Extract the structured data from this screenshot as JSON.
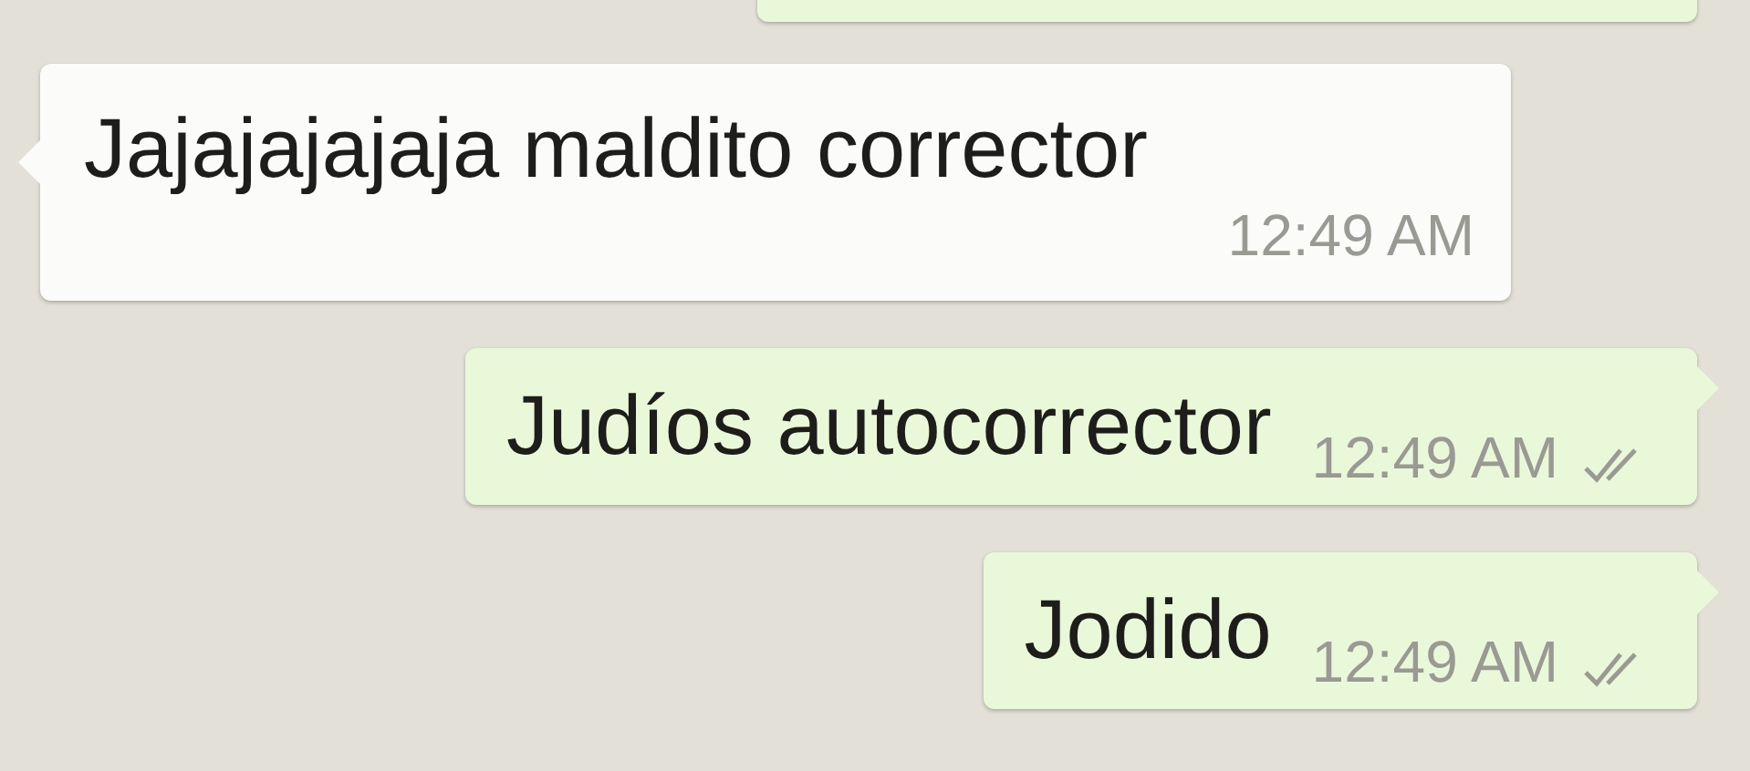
{
  "messages": [
    {
      "kind": "outgoing"
    },
    {
      "kind": "incoming",
      "text": "Jajajajajaja maldito corrector",
      "time": "12:49 AM"
    },
    {
      "kind": "outgoing",
      "text": "Judíos autocorrector",
      "time": "12:49 AM",
      "read": true
    },
    {
      "kind": "outgoing",
      "text": "Jodido",
      "time": "12:49 AM",
      "read": true
    }
  ]
}
